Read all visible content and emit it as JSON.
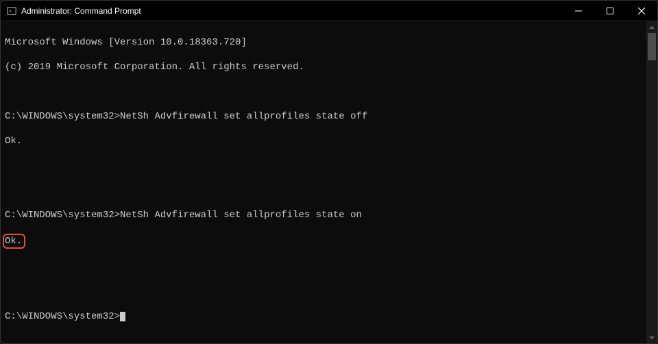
{
  "titlebar": {
    "title": "Administrator: Command Prompt"
  },
  "terminal": {
    "header_line1": "Microsoft Windows [Version 10.0.18363.720]",
    "header_line2": "(c) 2019 Microsoft Corporation. All rights reserved.",
    "block1": {
      "prompt": "C:\\WINDOWS\\system32>",
      "command": "NetSh Advfirewall set allprofiles state off",
      "result": "Ok."
    },
    "block2": {
      "prompt": "C:\\WINDOWS\\system32>",
      "command": "NetSh Advfirewall set allprofiles state on",
      "result": "Ok."
    },
    "current_prompt": "C:\\WINDOWS\\system32>"
  }
}
